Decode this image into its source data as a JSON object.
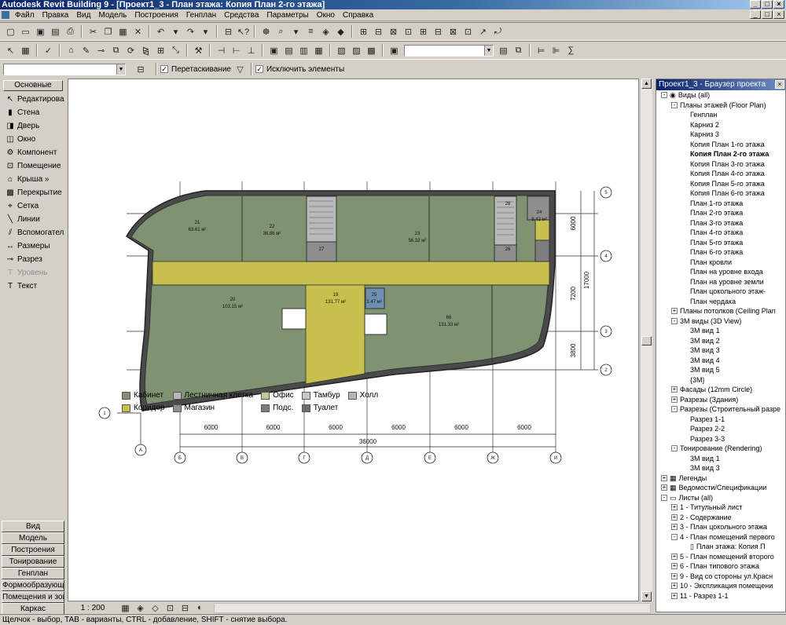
{
  "window": {
    "title": "Autodesk Revit Building 9 - [Проект1_3 - План этажа: Копия План 2-го этажа]",
    "min": "_",
    "max": "□",
    "close": "×"
  },
  "menu": [
    "Файл",
    "Правка",
    "Вид",
    "Модель",
    "Построения",
    "Генплан",
    "Средства",
    "Параметры",
    "Окно",
    "Справка"
  ],
  "options": {
    "checkbox1": "Перетаскивание",
    "checkbox2": "Исключить элементы"
  },
  "sidebar": {
    "header": "Основные",
    "tools": [
      {
        "label": "Редактирова",
        "icon": "arrow-cursor-icon"
      },
      {
        "label": "Стена",
        "icon": "wall-icon"
      },
      {
        "label": "Дверь",
        "icon": "door-icon"
      },
      {
        "label": "Окно",
        "icon": "window-icon"
      },
      {
        "label": "Компонент",
        "icon": "component-icon"
      },
      {
        "label": "Помещение",
        "icon": "room-icon"
      },
      {
        "label": "Крыша »",
        "icon": "roof-icon"
      },
      {
        "label": "Перекрытие",
        "icon": "floor-icon"
      },
      {
        "label": "Сетка",
        "icon": "grid-icon"
      },
      {
        "label": "Линии",
        "icon": "lines-icon"
      },
      {
        "label": "Вспомогател",
        "icon": "ref-plane-icon"
      },
      {
        "label": "Размеры",
        "icon": "dimension-icon"
      },
      {
        "label": "Разрез",
        "icon": "section-icon"
      },
      {
        "label": "Уровень",
        "icon": "level-icon"
      },
      {
        "label": "Текст",
        "icon": "text-icon"
      }
    ],
    "tabs": [
      "Вид",
      "Модель",
      "Построения",
      "Тонирование",
      "Генплан",
      "Формообразующие",
      "Помещения и зоны",
      "Каркас"
    ]
  },
  "view_status": {
    "scale": "1 : 200"
  },
  "status": "Щелчок - выбор, TAB - варианты, CTRL - добавление, SHIFT - снятие выбора.",
  "plan": {
    "rooms": [
      {
        "num": "21",
        "area": "63.61 м²"
      },
      {
        "num": "22",
        "area": "36.86 м²"
      },
      {
        "num": "27",
        "area": ""
      },
      {
        "num": "23",
        "area": "56.32 м²"
      },
      {
        "num": "28",
        "area": ""
      },
      {
        "num": "24",
        "area": "8.42 м²"
      },
      {
        "num": "26",
        "area": ""
      },
      {
        "num": "19",
        "area": "131.77 м²"
      },
      {
        "num": "25",
        "area": "3.47 м²"
      },
      {
        "num": "20",
        "area": "103.15 м²"
      },
      {
        "num": "66",
        "area": "131.33 м²"
      }
    ],
    "dims": {
      "bottom": [
        "6000",
        "6000",
        "6000",
        "6000",
        "6000",
        "6000"
      ],
      "total": "36000",
      "right": [
        "6000",
        "7200",
        "3800"
      ],
      "right_total": "17000"
    },
    "axes_h": [
      "5",
      "4",
      "3",
      "2",
      "1"
    ],
    "axes_v": [
      "Б",
      "В",
      "Г",
      "Д",
      "Е",
      "Ж",
      "И"
    ],
    "axis_a": "А"
  },
  "legend": [
    {
      "label": "Кабинет",
      "color": "#7f9372"
    },
    {
      "label": "Лестничная клетка",
      "color": "#b9b9b9"
    },
    {
      "label": "Офис",
      "color": "#c6c39a"
    },
    {
      "label": "Тамбур",
      "color": "#c8c8c8"
    },
    {
      "label": "Холл",
      "color": "#b5b5b5"
    },
    {
      "label": "Коридор",
      "color": "#c7bf4e"
    },
    {
      "label": "Магазин",
      "color": "#8e8e8e"
    },
    {
      "label": "Подс.",
      "color": "#7d7d7d"
    },
    {
      "label": "Туалет",
      "color": "#6e6e6e"
    }
  ],
  "browser": {
    "title": "Проект1_3 - Браузер проекта",
    "nodes": [
      {
        "t": "Виды (all)",
        "d": 0,
        "e": "-",
        "icon": "eye-icon"
      },
      {
        "t": "Планы этажей (Floor Plan)",
        "d": 1,
        "e": "-"
      },
      {
        "t": "Генплан",
        "d": 2
      },
      {
        "t": "Карниз 2",
        "d": 2
      },
      {
        "t": "Карниз 3",
        "d": 2
      },
      {
        "t": "Копия План 1-го этажа",
        "d": 2
      },
      {
        "t": "Копия План 2-го этажа",
        "d": 2,
        "b": true
      },
      {
        "t": "Копия План 3-го этажа",
        "d": 2
      },
      {
        "t": "Копия План 4-го этажа",
        "d": 2
      },
      {
        "t": "Копия План 5-го этажа",
        "d": 2
      },
      {
        "t": "Копия План 6-го этажа",
        "d": 2
      },
      {
        "t": "План 1-го этажа",
        "d": 2
      },
      {
        "t": "План 2-го этажа",
        "d": 2
      },
      {
        "t": "План 3-го этажа",
        "d": 2
      },
      {
        "t": "План 4-го этажа",
        "d": 2
      },
      {
        "t": "План 5-го этажа",
        "d": 2
      },
      {
        "t": "План 6-го этажа",
        "d": 2
      },
      {
        "t": "План кровли",
        "d": 2
      },
      {
        "t": "План на уровне входа",
        "d": 2
      },
      {
        "t": "План на уровне земли",
        "d": 2
      },
      {
        "t": "План цокольного этаж-",
        "d": 2
      },
      {
        "t": "План чердака",
        "d": 2
      },
      {
        "t": "Планы потолков (Ceiling Plan",
        "d": 1,
        "e": "+"
      },
      {
        "t": "3М виды (3D View)",
        "d": 1,
        "e": "-"
      },
      {
        "t": "3М вид 1",
        "d": 2
      },
      {
        "t": "3М вид 2",
        "d": 2
      },
      {
        "t": "3М вид 3",
        "d": 2
      },
      {
        "t": "3М вид 4",
        "d": 2
      },
      {
        "t": "3М вид 5",
        "d": 2
      },
      {
        "t": "{3M}",
        "d": 2
      },
      {
        "t": "Фасады (12mm Circle)",
        "d": 1,
        "e": "+"
      },
      {
        "t": "Разрезы (Здания)",
        "d": 1,
        "e": "+"
      },
      {
        "t": "Разрезы (Строительный разре",
        "d": 1,
        "e": "-"
      },
      {
        "t": "Разрез 1-1",
        "d": 2
      },
      {
        "t": "Разрез 2-2",
        "d": 2
      },
      {
        "t": "Разрез 3-3",
        "d": 2
      },
      {
        "t": "Тонирование (Rendering)",
        "d": 1,
        "e": "-"
      },
      {
        "t": "3М вид 1",
        "d": 2
      },
      {
        "t": "3М вид 3",
        "d": 2
      },
      {
        "t": "Легенды",
        "d": 0,
        "e": "+",
        "icon": "table-icon"
      },
      {
        "t": "Ведомости/Спецификации",
        "d": 0,
        "e": "+",
        "icon": "table-icon"
      },
      {
        "t": "Листы (all)",
        "d": 0,
        "e": "-",
        "icon": "sheet-icon"
      },
      {
        "t": "1 - Титульный лист",
        "d": 1,
        "e": "+"
      },
      {
        "t": "2 - Содержание",
        "d": 1,
        "e": "+"
      },
      {
        "t": "3 - План цокольного этажа",
        "d": 1,
        "e": "+"
      },
      {
        "t": "4 - План помещений первого",
        "d": 1,
        "e": "-"
      },
      {
        "t": "План этажа: Копия П",
        "d": 2,
        "icon": "doc-icon"
      },
      {
        "t": "5 - План помещений второго",
        "d": 1,
        "e": "+"
      },
      {
        "t": "6 - План типового этажа",
        "d": 1,
        "e": "+"
      },
      {
        "t": "9 - Вид со стороны ул.Красн",
        "d": 1,
        "e": "+"
      },
      {
        "t": "10 - Экспликация помещени",
        "d": 1,
        "e": "+"
      },
      {
        "t": "11 - Разрез 1-1",
        "d": 1,
        "e": "+"
      }
    ]
  }
}
